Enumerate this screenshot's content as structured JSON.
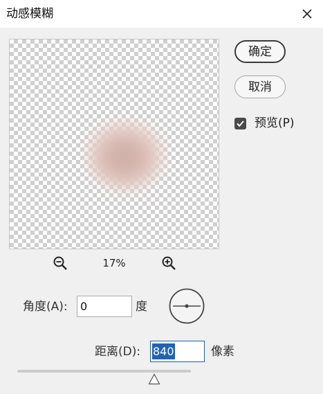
{
  "dialog": {
    "title": "动感模糊",
    "close_icon": "close-icon"
  },
  "buttons": {
    "ok_label": "确定",
    "cancel_label": "取消"
  },
  "preview": {
    "checked": true,
    "label": "预览(P)"
  },
  "zoom": {
    "level": "17%",
    "zoom_out_icon": "zoom-out-icon",
    "zoom_in_icon": "zoom-in-icon"
  },
  "angle": {
    "label": "角度(A):",
    "value": "0",
    "unit": "度"
  },
  "distance": {
    "label": "距离(D):",
    "value": "840",
    "unit": "像素",
    "slider_fraction": 0.79
  },
  "colors": {
    "selection": "#1f63b5",
    "checkbox": "#4a4a4a"
  }
}
